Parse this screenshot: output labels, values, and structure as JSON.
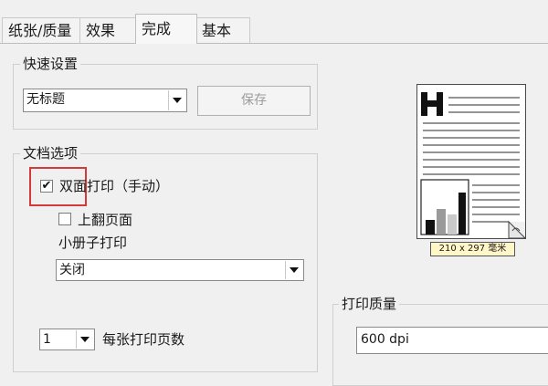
{
  "tabs": [
    {
      "label": "纸张/质量",
      "active": false
    },
    {
      "label": "效果",
      "active": false
    },
    {
      "label": "完成",
      "active": true
    },
    {
      "label": "基本",
      "active": false
    }
  ],
  "quick_settings": {
    "legend": "快速设置",
    "selected": "无标题",
    "save_label": "保存"
  },
  "document_options": {
    "legend": "文档选项",
    "duplex_label": "双面打印（手动）",
    "duplex_checked": true,
    "flip_up_label": "上翻页面",
    "flip_up_checked": false,
    "booklet_label": "小册子打印",
    "booklet_value": "关闭",
    "pages_per_sheet_value": "1",
    "pages_per_sheet_label": "每张打印页数"
  },
  "preview": {
    "size_label": "210 x 297 毫米"
  },
  "print_quality": {
    "legend": "打印质量",
    "value": "600 dpi"
  },
  "colors": {
    "highlight": "#d43a3a",
    "size_label_bg": "#fff7c8"
  }
}
